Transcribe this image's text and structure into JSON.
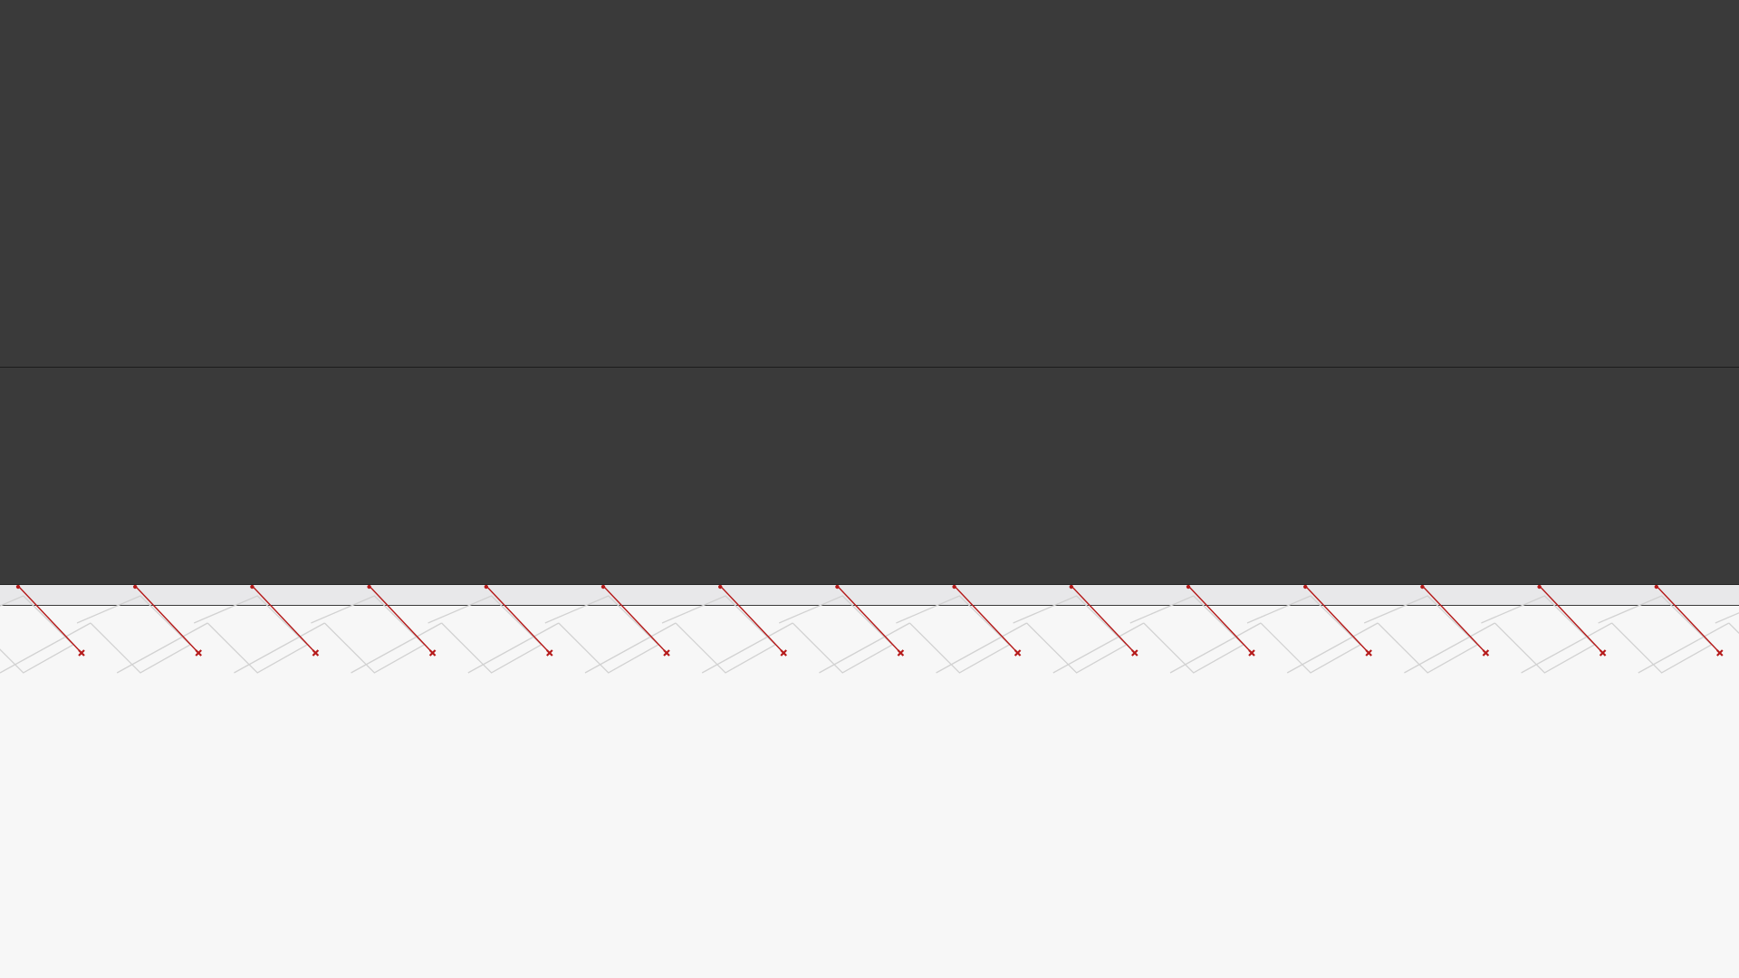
{
  "colors": {
    "panel_background": "#3a3a3a",
    "panel_divider": "#1c1c1c",
    "ruler_background": "#e8e8ea",
    "canvas_background": "#f7f7f7",
    "guide_line": "#d2d2d2",
    "path_stroke": "#b51a1a",
    "anchor_marker": "#b51a1a"
  },
  "icons": {
    "anchor_marker": "cross-marker-icon"
  }
}
